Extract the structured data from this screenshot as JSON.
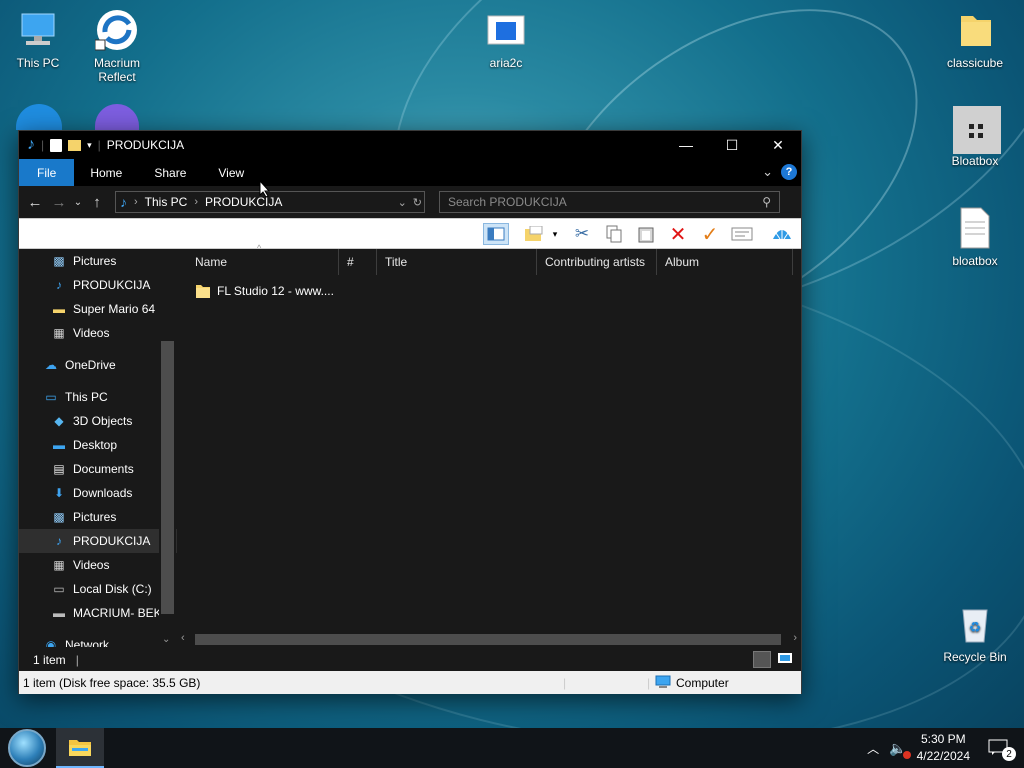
{
  "desktop": {
    "icons": [
      {
        "label": "This PC"
      },
      {
        "label": "Macrium Reflect"
      },
      {
        "label": "aria2c"
      },
      {
        "label": "classicube"
      },
      {
        "label": "Bloatbox"
      },
      {
        "label": "bloatbox"
      },
      {
        "label": "Recycle Bin"
      }
    ]
  },
  "window": {
    "title": "PRODUKCIJA",
    "controls": {
      "minimize": "—",
      "maximize": "☐",
      "close": "✕"
    },
    "ribbon_tabs": [
      "File",
      "Home",
      "Share",
      "View"
    ],
    "address": {
      "crumbs": [
        "This PC",
        "PRODUKCIJA"
      ]
    },
    "search": {
      "placeholder": "Search PRODUKCIJA"
    },
    "nav_pane": [
      {
        "label": "Pictures",
        "icon": "pictures-icon",
        "indent": 2,
        "pinned": true
      },
      {
        "label": "PRODUKCIJA",
        "icon": "music-icon",
        "indent": 2,
        "pinned": true
      },
      {
        "label": "Super Mario 64 (",
        "icon": "folder-icon",
        "indent": 2
      },
      {
        "label": "Videos",
        "icon": "videos-icon",
        "indent": 2
      },
      {
        "label": "",
        "icon": "",
        "indent": 0
      },
      {
        "label": "OneDrive",
        "icon": "cloud-icon",
        "indent": 1
      },
      {
        "label": "",
        "icon": "",
        "indent": 0
      },
      {
        "label": "This PC",
        "icon": "pc-icon",
        "indent": 1
      },
      {
        "label": "3D Objects",
        "icon": "cube-icon",
        "indent": 2
      },
      {
        "label": "Desktop",
        "icon": "desktop-icon",
        "indent": 2
      },
      {
        "label": "Documents",
        "icon": "document-icon",
        "indent": 2
      },
      {
        "label": "Downloads",
        "icon": "download-icon",
        "indent": 2
      },
      {
        "label": "Pictures",
        "icon": "pictures-icon",
        "indent": 2
      },
      {
        "label": "PRODUKCIJA",
        "icon": "music-icon",
        "indent": 2,
        "selected": true
      },
      {
        "label": "Videos",
        "icon": "videos-icon",
        "indent": 2
      },
      {
        "label": "Local Disk (C:)",
        "icon": "disk-icon",
        "indent": 2
      },
      {
        "label": "MACRIUM- BEK",
        "icon": "drive-icon",
        "indent": 2
      },
      {
        "label": "",
        "icon": "",
        "indent": 0
      },
      {
        "label": "Network",
        "icon": "network-icon",
        "indent": 1
      }
    ],
    "columns": [
      "Name",
      "#",
      "Title",
      "Contributing artists",
      "Album"
    ],
    "files": [
      {
        "name": "FL Studio 12 - www...."
      }
    ],
    "status": {
      "count": "1 item",
      "details": "1 item (Disk free space: 35.5 GB)",
      "location": "Computer"
    }
  },
  "taskbar": {
    "clock_time": "5:30 PM",
    "clock_date": "4/22/2024",
    "notification_count": "2"
  }
}
